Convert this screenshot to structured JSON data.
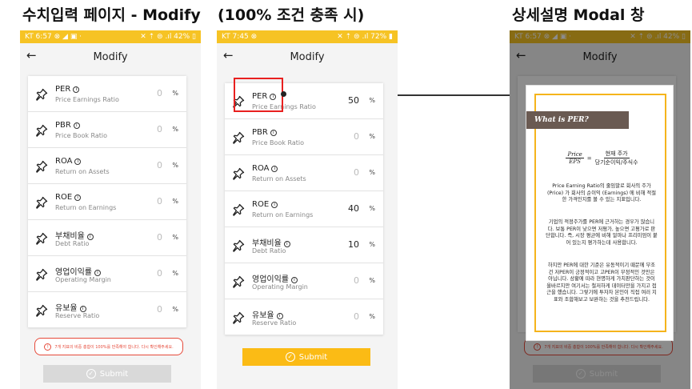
{
  "titles": {
    "left": "수치입력 페이지 - Modify",
    "middle": "(100% 조건 충족 시)",
    "right": "상세설명 Modal 창"
  },
  "colors": {
    "accent": "#f6c324",
    "warning": "#e64a3a",
    "modal_border": "#f5b41c",
    "callout": "#e8201f"
  },
  "phone1": {
    "status_left": "KT 6:57 ⊗ ◢ ▣ ·",
    "status_right": "✕ ⇡ ⊜ .ıl 42% ▯",
    "back_icon": "←",
    "title": "Modify",
    "rows": [
      {
        "name": "PER",
        "info": "i",
        "sub": "Price Earnings Ratio",
        "value": "0",
        "unit": "%"
      },
      {
        "name": "PBR",
        "info": "i",
        "sub": "Price Book Ratio",
        "value": "0",
        "unit": "%"
      },
      {
        "name": "ROA",
        "info": "i",
        "sub": "Return on Assets",
        "value": "0",
        "unit": "%"
      },
      {
        "name": "ROE",
        "info": "i",
        "sub": "Return on Earnings",
        "value": "0",
        "unit": "%"
      },
      {
        "name": "부채비율",
        "info": "i",
        "sub": "Debt Ratio",
        "value": "0",
        "unit": "%"
      },
      {
        "name": "영업이익률",
        "info": "i",
        "sub": "Operating Margin",
        "value": "0",
        "unit": "%"
      },
      {
        "name": "유보율",
        "info": "i",
        "sub": "Reserve Ratio",
        "value": "0",
        "unit": "%"
      }
    ],
    "warning_icon": "!",
    "warning": "7개 지표의 비중 총합이 100%를 만족해야 합니다. 다시 확인해주세요.",
    "submit": "Submit",
    "check_icon": "✓"
  },
  "phone2": {
    "status_left": "KT 7:45 ⊗",
    "status_right": "✕ ⇡ ⊜ .ıl 72% ▮",
    "back_icon": "←",
    "title": "Modify",
    "rows": [
      {
        "name": "PER",
        "info": "i",
        "sub": "Price Earnings Ratio",
        "value": "50",
        "unit": "%"
      },
      {
        "name": "PBR",
        "info": "i",
        "sub": "Price Book Ratio",
        "value": "0",
        "unit": "%"
      },
      {
        "name": "ROA",
        "info": "i",
        "sub": "Return on Assets",
        "value": "0",
        "unit": "%"
      },
      {
        "name": "ROE",
        "info": "i",
        "sub": "Return on Earnings",
        "value": "40",
        "unit": "%"
      },
      {
        "name": "부채비율",
        "info": "i",
        "sub": "Debt Ratio",
        "value": "10",
        "unit": "%"
      },
      {
        "name": "영업이익률",
        "info": "i",
        "sub": "Operating Margin",
        "value": "0",
        "unit": "%"
      },
      {
        "name": "유보율",
        "info": "i",
        "sub": "Reserve Ratio",
        "value": "0",
        "unit": "%"
      }
    ],
    "submit": "Submit",
    "check_icon": "✓"
  },
  "phone3": {
    "status_left": "KT 6:57 ⊗ ◢ ▣ ·",
    "status_right": "✕ ⇡ ⊜ .ıl 42% ▯",
    "back_icon": "←",
    "title": "Modify",
    "warning": "7개 지표의 비중 총합이 100%를 만족해야 합니다. 다시 확인해주세요.",
    "submit": "Submit",
    "check_icon": "✓",
    "modal": {
      "heading": "What is  PER?",
      "formula": {
        "left_num": "Price",
        "left_den": "EPS",
        "eq": "=",
        "right_num": "현재 주가",
        "right_den": "당기순이익/주식수"
      },
      "para1": "Price Earning Ratio의 줄임말로 회사의 주가 (Price) 가 회사의 순이익 (Earnings) 에 비해 적절한 가격인지를 볼 수 있는 지표입니다.",
      "para2": "기업의 적정주가를 PER에 근거하는 경우가 많습니다. 보통 PER이 낮으면 저평가, 높으면 고평가로 판단합니다. 즉, 시장 평균에 비해 얼마나 프리미엄이 붙어 있는지 평가하는데 사용합니다.",
      "para3": "하지만 PER에 대한 기준은 유동적이기 때문에 무조건 저PER이 긍정적이고 고PER이 부정적인 것만은 아닙니다. 상황에 따라 현명하게 가치판단하는 것이 올바르지만 여기서는 철저하게 데이터만을 가지고 접근을 했습니다. 그렇기에 투자자 본인이 직접 여러 지표와 조합해보고 보완하는 것을 추천드립니다."
    }
  }
}
